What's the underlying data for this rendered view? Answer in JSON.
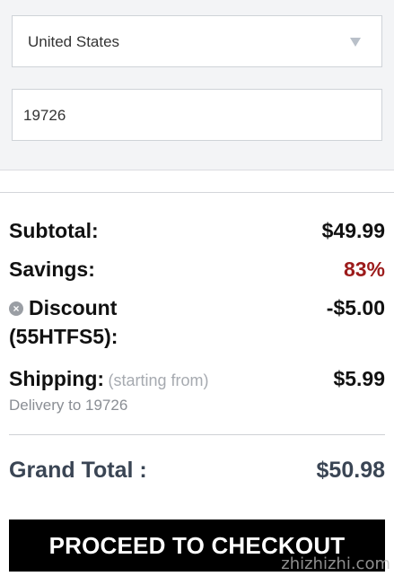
{
  "shipping_form": {
    "country_value": "United States",
    "zip_value": "19726"
  },
  "summary": {
    "subtotal_label": "Subtotal:",
    "subtotal_value": "$49.99",
    "savings_label": "Savings:",
    "savings_value": "83%",
    "discount_label": "Discount",
    "discount_code": "(55HTFS5):",
    "discount_value": "-$5.00",
    "shipping_label": "Shipping:",
    "shipping_note": "(starting from)",
    "shipping_value": "$5.99",
    "delivery_text": "Delivery to 19726",
    "grand_total_label": "Grand Total :",
    "grand_total_value": "$50.98"
  },
  "checkout_label": "PROCEED TO CHECKOUT",
  "watermark_text": "zhizhizhi.com",
  "colors": {
    "savings": "#9c1b1b",
    "grand_total": "#3a4554",
    "button_bg": "#000000"
  }
}
